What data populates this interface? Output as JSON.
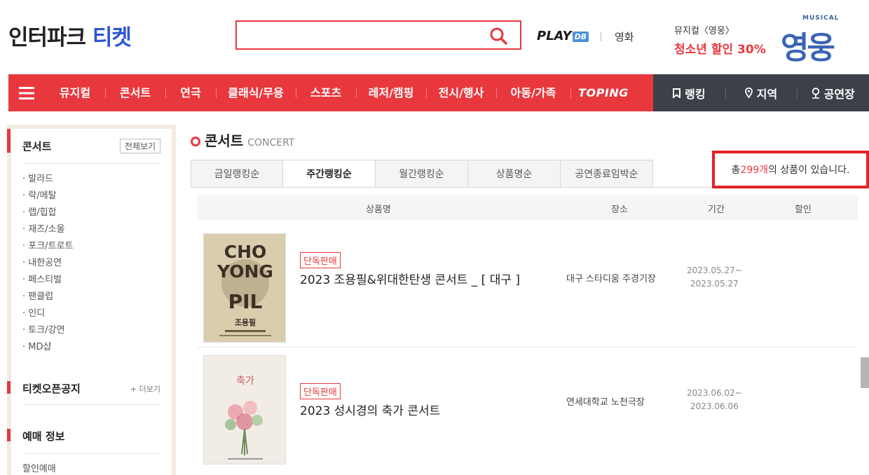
{
  "header": {
    "logo_main": "인터파크",
    "logo_accent": "티켓",
    "search": {
      "placeholder": "",
      "value": ""
    },
    "playdb_label": "PLAY",
    "playdb_badge": "DB",
    "movie_link": "영화",
    "promo": {
      "line1": "뮤지컬〈영웅〉",
      "line2": "청소년 할인 30%",
      "logo_small": "MUSICAL",
      "logo_big": "영웅"
    }
  },
  "nav": {
    "items": [
      "뮤지컬",
      "콘서트",
      "연극",
      "클래식/무용",
      "스포츠",
      "레저/캠핑",
      "전시/행사",
      "아동/가족",
      "TOPING"
    ],
    "right": [
      "랭킹",
      "지역",
      "공연장"
    ]
  },
  "sidebar": {
    "title": "콘서트",
    "view_all": "전체보기",
    "genres": [
      "· 발라드",
      "· 락/메탈",
      "· 랩/힙합",
      "· 재즈/소울",
      "· 포크/트로트",
      "· 내한공연",
      "· 페스티벌",
      "· 팬클럽",
      "· 인디",
      "· 토크/강연",
      "· MD샵"
    ],
    "notice_title": "티켓오픈공지",
    "notice_more": "+ 더보기",
    "booking_title": "예매 정보",
    "booking_sub": "할인예매"
  },
  "main": {
    "title_ko": "콘서트",
    "title_en": "CONCERT",
    "tabs": [
      "금일랭킹순",
      "주간랭킹순",
      "월간랭킹순",
      "상품명순",
      "공연종료임박순"
    ],
    "active_tab": 1,
    "count": {
      "prefix": "총 ",
      "number": "299개",
      "suffix": "의 상품이 있습니다."
    },
    "columns": [
      "상품명",
      "장소",
      "기간",
      "할인"
    ],
    "products": [
      {
        "badge": "단독판매",
        "name": "2023 조용필&위대한탄생 콘서트 _ [ 대구 ]",
        "venue": "대구 스타디움 주경기장",
        "start": "2023.05.27~",
        "end": "2023.05.27",
        "poster_text": "CHO YONG PIL",
        "poster_sub": "조용필"
      },
      {
        "badge": "단독판매",
        "name": "2023 성시경의 축가 콘서트",
        "venue": "연세대학교 노천극장",
        "start": "2023.06.02~",
        "end": "2023.06.06",
        "poster_text": "축가",
        "poster_sub": ""
      }
    ]
  },
  "colors": {
    "brand_red": "#e8383e",
    "nav_dark": "#3c4048",
    "logo_blue": "#2c56d6"
  }
}
